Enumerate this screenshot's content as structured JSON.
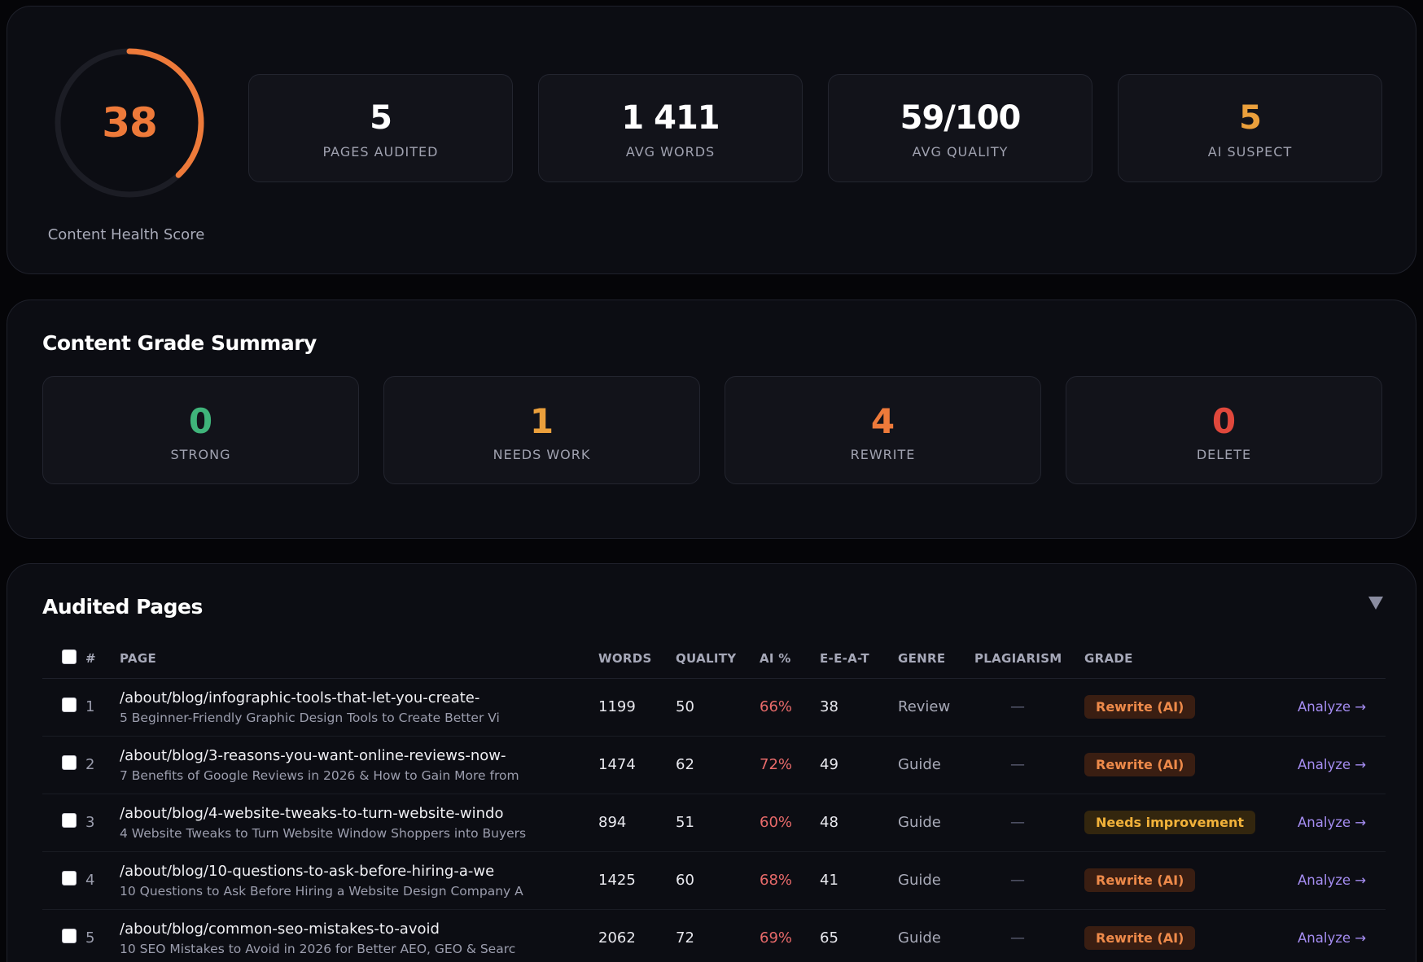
{
  "health": {
    "score": "38",
    "score_value": 38,
    "score_caption": "Content Health Score",
    "stats": [
      {
        "value": "5",
        "label": "PAGES AUDITED",
        "color": "#ffffff"
      },
      {
        "value": "1 411",
        "label": "AVG WORDS",
        "color": "#ffffff"
      },
      {
        "value": "59/100",
        "label": "AVG QUALITY",
        "color": "#ffffff"
      },
      {
        "value": "5",
        "label": "AI SUSPECT",
        "color": "#eba03c"
      }
    ],
    "accent_color": "#ee7a3a"
  },
  "grades": {
    "title": "Content Grade Summary",
    "items": [
      {
        "value": "0",
        "label": "STRONG",
        "color": "#3fb47a"
      },
      {
        "value": "1",
        "label": "NEEDS WORK",
        "color": "#eba03c"
      },
      {
        "value": "4",
        "label": "REWRITE",
        "color": "#ee7a3a"
      },
      {
        "value": "0",
        "label": "DELETE",
        "color": "#e0483c"
      }
    ]
  },
  "pages": {
    "title": "Audited Pages",
    "collapse_icon": "triangle-down-icon",
    "columns": [
      "#",
      "PAGE",
      "WORDS",
      "QUALITY",
      "AI %",
      "E-E-A-T",
      "GENRE",
      "PLAGIARISM",
      "GRADE",
      ""
    ],
    "rows": [
      {
        "num": "1",
        "url": "/about/blog/infographic-tools-that-let-you-create-",
        "subtitle": "5 Beginner-Friendly Graphic Design Tools to Create Better Vi",
        "words": "1199",
        "quality": "50",
        "ai": "66%",
        "eeat": "38",
        "genre": "Review",
        "plagiarism": "—",
        "grade": "Rewrite (AI)",
        "grade_type": "rewrite",
        "action": "Analyze →"
      },
      {
        "num": "2",
        "url": "/about/blog/3-reasons-you-want-online-reviews-now-",
        "subtitle": "7 Benefits of Google Reviews in 2026 & How to Gain More from",
        "words": "1474",
        "quality": "62",
        "ai": "72%",
        "eeat": "49",
        "genre": "Guide",
        "plagiarism": "—",
        "grade": "Rewrite (AI)",
        "grade_type": "rewrite",
        "action": "Analyze →"
      },
      {
        "num": "3",
        "url": "/about/blog/4-website-tweaks-to-turn-website-windo",
        "subtitle": "4 Website Tweaks to Turn Website Window Shoppers into Buyers",
        "words": "894",
        "quality": "51",
        "ai": "60%",
        "eeat": "48",
        "genre": "Guide",
        "plagiarism": "—",
        "grade": "Needs improvement",
        "grade_type": "needs",
        "action": "Analyze →"
      },
      {
        "num": "4",
        "url": "/about/blog/10-questions-to-ask-before-hiring-a-we",
        "subtitle": "10 Questions to Ask Before Hiring a Website Design Company A",
        "words": "1425",
        "quality": "60",
        "ai": "68%",
        "eeat": "41",
        "genre": "Guide",
        "plagiarism": "—",
        "grade": "Rewrite (AI)",
        "grade_type": "rewrite",
        "action": "Analyze →"
      },
      {
        "num": "5",
        "url": "/about/blog/common-seo-mistakes-to-avoid",
        "subtitle": "10 SEO Mistakes to Avoid in 2026 for Better AEO, GEO & Searc",
        "words": "2062",
        "quality": "72",
        "ai": "69%",
        "eeat": "65",
        "genre": "Guide",
        "plagiarism": "—",
        "grade": "Rewrite (AI)",
        "grade_type": "rewrite",
        "action": "Analyze →"
      }
    ]
  }
}
